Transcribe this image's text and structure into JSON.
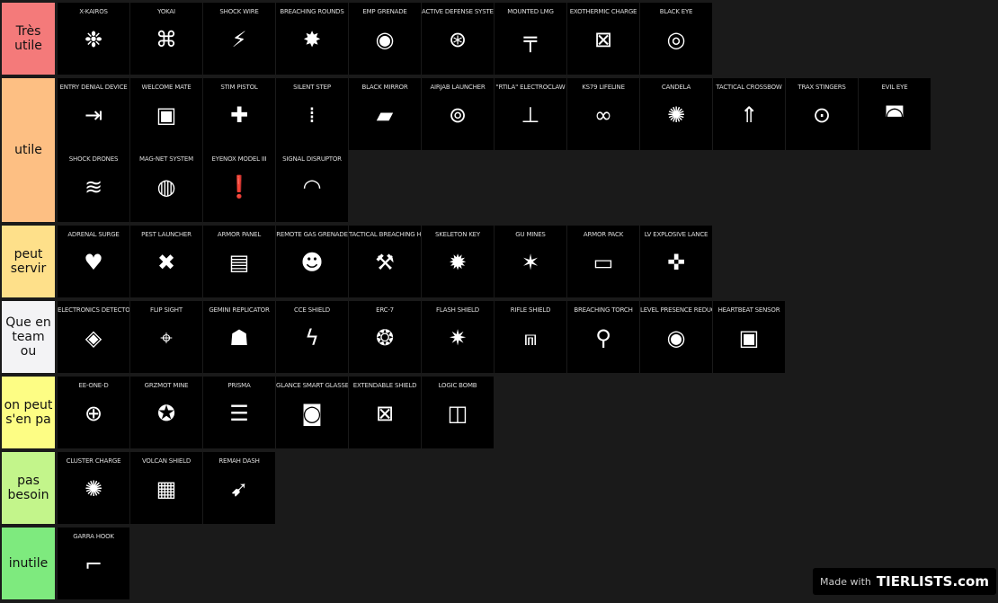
{
  "tiers": [
    {
      "label": "Très utile",
      "color": "#F47A7A",
      "items": [
        {
          "name": "X-KAIROS",
          "icon": "❉"
        },
        {
          "name": "YOKAI",
          "icon": "⌘"
        },
        {
          "name": "SHOCK WIRE",
          "icon": "⚡"
        },
        {
          "name": "BREACHING ROUNDS",
          "icon": "✸"
        },
        {
          "name": "EMP GRENADE",
          "icon": "◉"
        },
        {
          "name": "ACTIVE DEFENSE SYSTEM",
          "icon": "⊛"
        },
        {
          "name": "MOUNTED LMG",
          "icon": "╤"
        },
        {
          "name": "EXOTHERMIC CHARGE",
          "icon": "⊠"
        },
        {
          "name": "BLACK EYE",
          "icon": "◎"
        }
      ]
    },
    {
      "label": "utile",
      "color": "#FDBF83",
      "items": [
        {
          "name": "ENTRY DENIAL DEVICE",
          "icon": "⇥"
        },
        {
          "name": "WELCOME MATE",
          "icon": "▣"
        },
        {
          "name": "STIM PISTOL",
          "icon": "✚"
        },
        {
          "name": "SILENT STEP",
          "icon": "⁞"
        },
        {
          "name": "BLACK MIRROR",
          "icon": "▰"
        },
        {
          "name": "AIRJAB LAUNCHER",
          "icon": "⊚"
        },
        {
          "name": "\"RTILA\" ELECTROCLAW",
          "icon": "⊥"
        },
        {
          "name": "KS79 LIFELINE",
          "icon": "∞"
        },
        {
          "name": "CANDELA",
          "icon": "✺"
        },
        {
          "name": "TACTICAL CROSSBOW",
          "icon": "⇑"
        },
        {
          "name": "TRAX STINGERS",
          "icon": "⊙"
        },
        {
          "name": "EVIL EYE",
          "icon": "◚"
        },
        {
          "name": "SHOCK DRONES",
          "icon": "≋"
        },
        {
          "name": "MAG-NET SYSTEM",
          "icon": "◍"
        },
        {
          "name": "EYENOX MODEL III",
          "icon": "❗"
        },
        {
          "name": "SIGNAL DISRUPTOR",
          "icon": "◠"
        }
      ]
    },
    {
      "label": "peut servir",
      "color": "#FEE08A",
      "items": [
        {
          "name": "ADRENAL SURGE",
          "icon": "♥"
        },
        {
          "name": "PEST LAUNCHER",
          "icon": "✖"
        },
        {
          "name": "ARMOR PANEL",
          "icon": "▤"
        },
        {
          "name": "REMOTE GAS GRENADE",
          "icon": "☻"
        },
        {
          "name": "TACTICAL BREACHING HAMMER",
          "icon": "⚒"
        },
        {
          "name": "SKELETON KEY",
          "icon": "✹"
        },
        {
          "name": "GU MINES",
          "icon": "✶"
        },
        {
          "name": "ARMOR PACK",
          "icon": "▭"
        },
        {
          "name": "LV EXPLOSIVE LANCE",
          "icon": "✜"
        }
      ]
    },
    {
      "label": "Que en team ou",
      "color": "#F3F3F5",
      "items": [
        {
          "name": "ELECTRONICS DETECTOR",
          "icon": "◈"
        },
        {
          "name": "FLIP SIGHT",
          "icon": "⌖"
        },
        {
          "name": "GEMINI REPLICATOR",
          "icon": "☗"
        },
        {
          "name": "CCE SHIELD",
          "icon": "ϟ"
        },
        {
          "name": "ERC-7",
          "icon": "❂"
        },
        {
          "name": "FLASH SHIELD",
          "icon": "✷"
        },
        {
          "name": "RIFLE SHIELD",
          "icon": "⩎"
        },
        {
          "name": "BREACHING TORCH",
          "icon": "⚲"
        },
        {
          "name": "LEVEL PRESENCE REDUCTION",
          "icon": "◉"
        },
        {
          "name": "HEARTBEAT SENSOR",
          "icon": "▣"
        }
      ]
    },
    {
      "label": "on peut s'en pa",
      "color": "#FDFD84",
      "items": [
        {
          "name": "EE-ONE-D",
          "icon": "⊕"
        },
        {
          "name": "GRZMOT MINE",
          "icon": "✪"
        },
        {
          "name": "PRISMA",
          "icon": "☰"
        },
        {
          "name": "GLANCE SMART GLASSES",
          "icon": "◙"
        },
        {
          "name": "EXTENDABLE SHIELD",
          "icon": "⊠"
        },
        {
          "name": "LOGIC BOMB",
          "icon": "◫"
        }
      ]
    },
    {
      "label": "pas besoin",
      "color": "#C3F58B",
      "items": [
        {
          "name": "CLUSTER CHARGE",
          "icon": "✺"
        },
        {
          "name": "VOLCAN SHIELD",
          "icon": "▦"
        },
        {
          "name": "REMAH DASH",
          "icon": "➹"
        }
      ]
    },
    {
      "label": "inutile",
      "color": "#7EEA7E",
      "items": [
        {
          "name": "GARRA HOOK",
          "icon": "⌐"
        }
      ]
    }
  ],
  "watermark": {
    "made_with": "Made with",
    "logo": "TIERLISTS.com"
  }
}
